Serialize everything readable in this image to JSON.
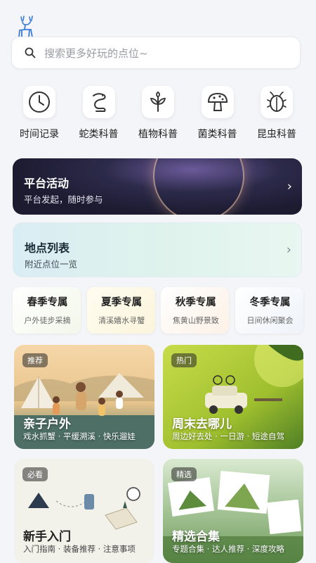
{
  "logo": {
    "icon": "deer-icon",
    "color": "#3a7bd5"
  },
  "search": {
    "placeholder": "搜索更多好玩的点位~",
    "icon": "search-icon"
  },
  "categories": [
    {
      "label": "时间记录",
      "icon": "clock-icon"
    },
    {
      "label": "蛇类科普",
      "icon": "snake-icon"
    },
    {
      "label": "植物科普",
      "icon": "plant-icon"
    },
    {
      "label": "菌类科普",
      "icon": "mushroom-icon"
    },
    {
      "label": "昆虫科普",
      "icon": "beetle-icon"
    }
  ],
  "banners": {
    "activity": {
      "title": "平台活动",
      "subtitle": "平台发起，随时参与",
      "chevron": "›"
    },
    "locations": {
      "title": "地点列表",
      "subtitle": "附近点位一览",
      "chevron": "›"
    }
  },
  "seasons": [
    {
      "title": "春季专属",
      "subtitle": "户外徒步采摘"
    },
    {
      "title": "夏季专属",
      "subtitle": "清溪嬉水寻蟹"
    },
    {
      "title": "秋季专属",
      "subtitle": "焦黄山野景致"
    },
    {
      "title": "冬季专属",
      "subtitle": "日间休闲聚会"
    }
  ],
  "cards": [
    {
      "tag": "推荐",
      "title": "亲子户外",
      "subtitle": "戏水抓蟹 · 平缓溯溪 · 快乐遛娃"
    },
    {
      "tag": "热门",
      "title": "周末去哪儿",
      "subtitle": "周边好去处 · 一日游 · 短途自驾"
    },
    {
      "tag": "必看",
      "title": "新手入门",
      "subtitle": "入门指南 · 装备推荐 · 注意事项"
    },
    {
      "tag": "精选",
      "title": "精选合集",
      "subtitle": "专题合集 · 达人推荐 · 深度攻略"
    }
  ]
}
